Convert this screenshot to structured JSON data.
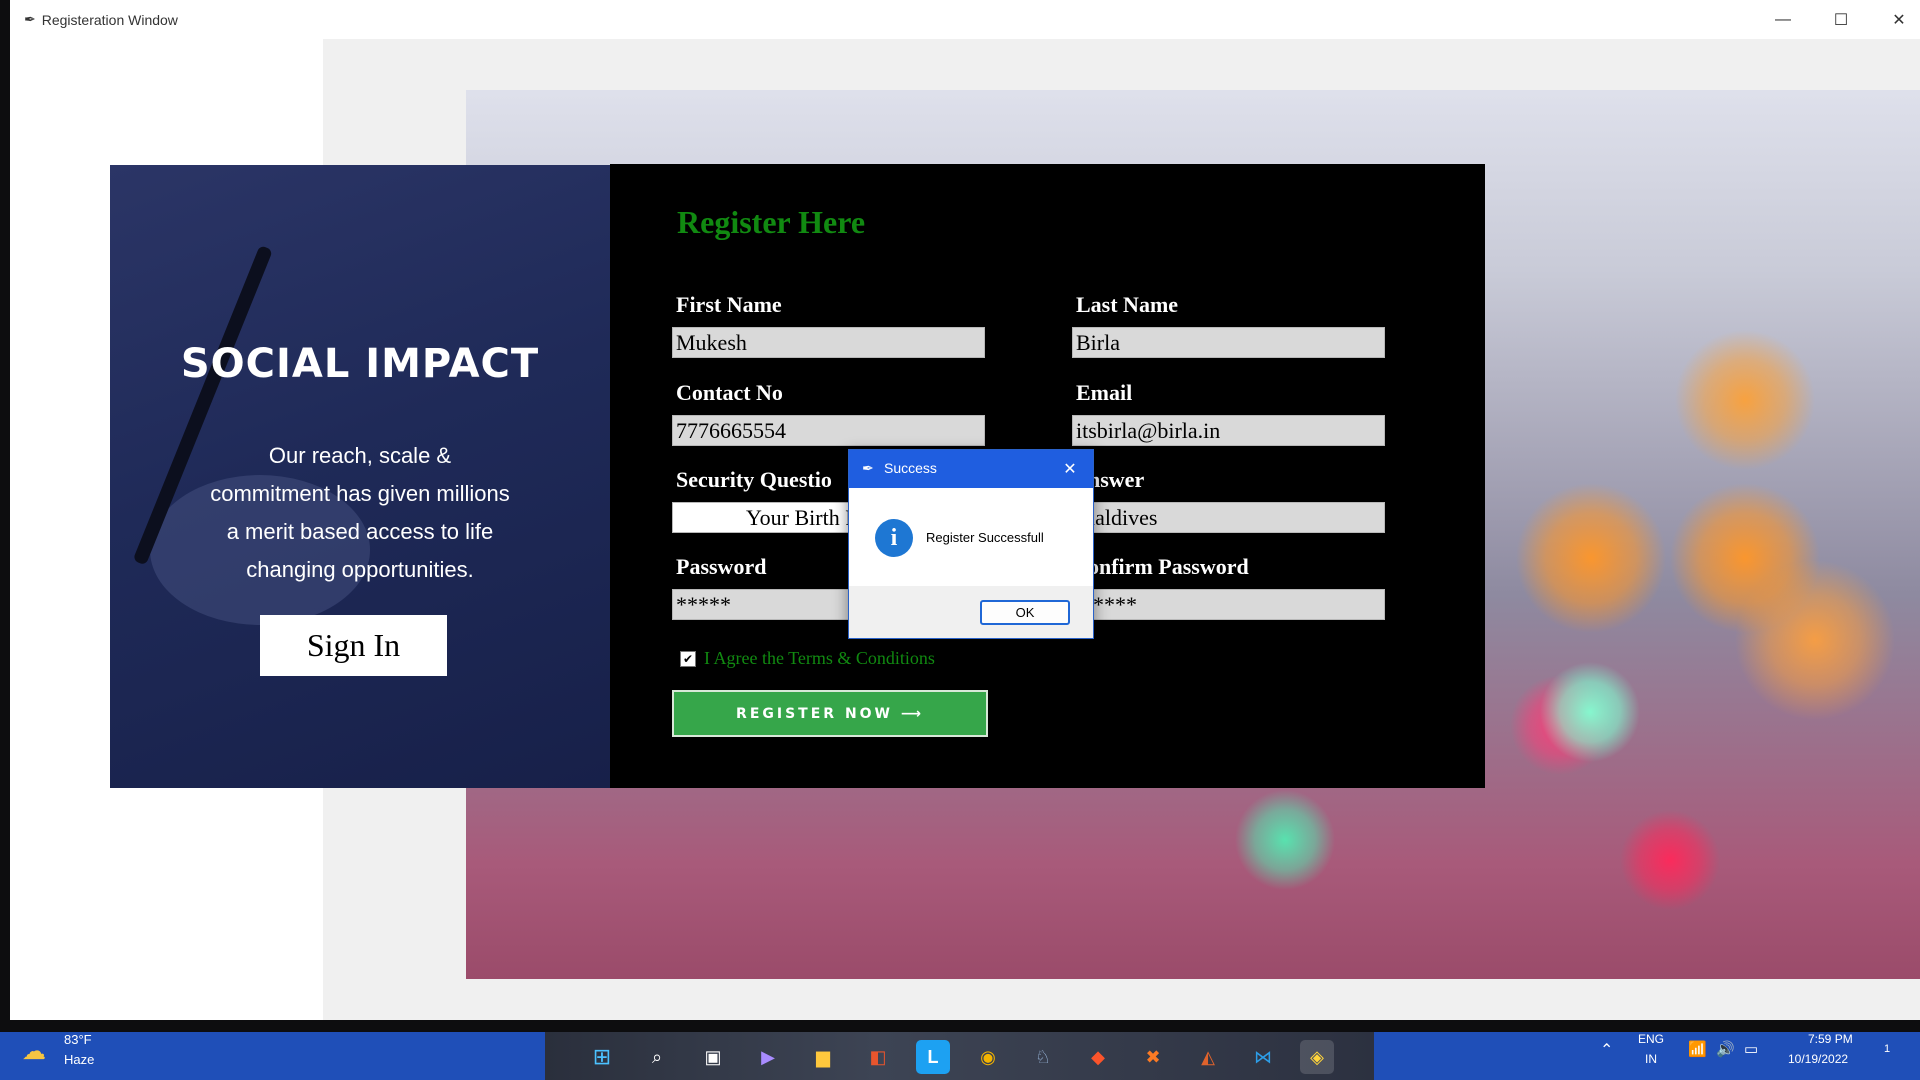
{
  "window": {
    "title": "Registeration Window",
    "controls": {
      "minimize": "—",
      "maximize": "☐",
      "close": "✕"
    }
  },
  "brand": {
    "title": "SOCIAL IMPACT",
    "tagline_lines": [
      "Our reach, scale &",
      "commitment has given millions",
      "a merit based access to life",
      "changing opportunities."
    ],
    "signin_label": "Sign In"
  },
  "form": {
    "title": "Register Here",
    "first_name": {
      "label": "First Name",
      "value": "Mukesh"
    },
    "last_name": {
      "label": "Last Name",
      "value": "Birla"
    },
    "contact": {
      "label": "Contact No",
      "value": "7776665554"
    },
    "email": {
      "label": "Email",
      "value": "itsbirla@birla.in"
    },
    "security_question": {
      "label": "Security Questio",
      "value": "Your Birth P"
    },
    "answer": {
      "label": "nswer",
      "value": "laldives"
    },
    "password": {
      "label": "Password",
      "value": "*****"
    },
    "confirm_password": {
      "label": "onfirm Password",
      "value": "****"
    },
    "terms": {
      "label": "I Agree the Terms & Conditions",
      "checked": true
    },
    "register_label": "REGISTER NOW ⟶"
  },
  "dialog": {
    "title": "Success",
    "message": "Register Successfull",
    "ok_label": "OK",
    "info_glyph": "i"
  },
  "taskbar": {
    "weather": {
      "temp": "83°F",
      "condition": "Haze"
    },
    "language": {
      "line1": "ENG",
      "line2": "IN"
    },
    "time": "7:59 PM",
    "date": "10/19/2022",
    "notification_count": "1",
    "apps": [
      "windows-start",
      "search",
      "task-view",
      "teams-chat",
      "file-explorer",
      "office",
      "app-l",
      "chrome",
      "postgresql",
      "brave",
      "xampp",
      "git-tool",
      "vscode",
      "python"
    ]
  },
  "colors": {
    "form_title": "#118a11",
    "register_button": "#36a64a",
    "dialog_titlebar": "#1f5ee0",
    "taskbar": "#1f4fb8"
  }
}
